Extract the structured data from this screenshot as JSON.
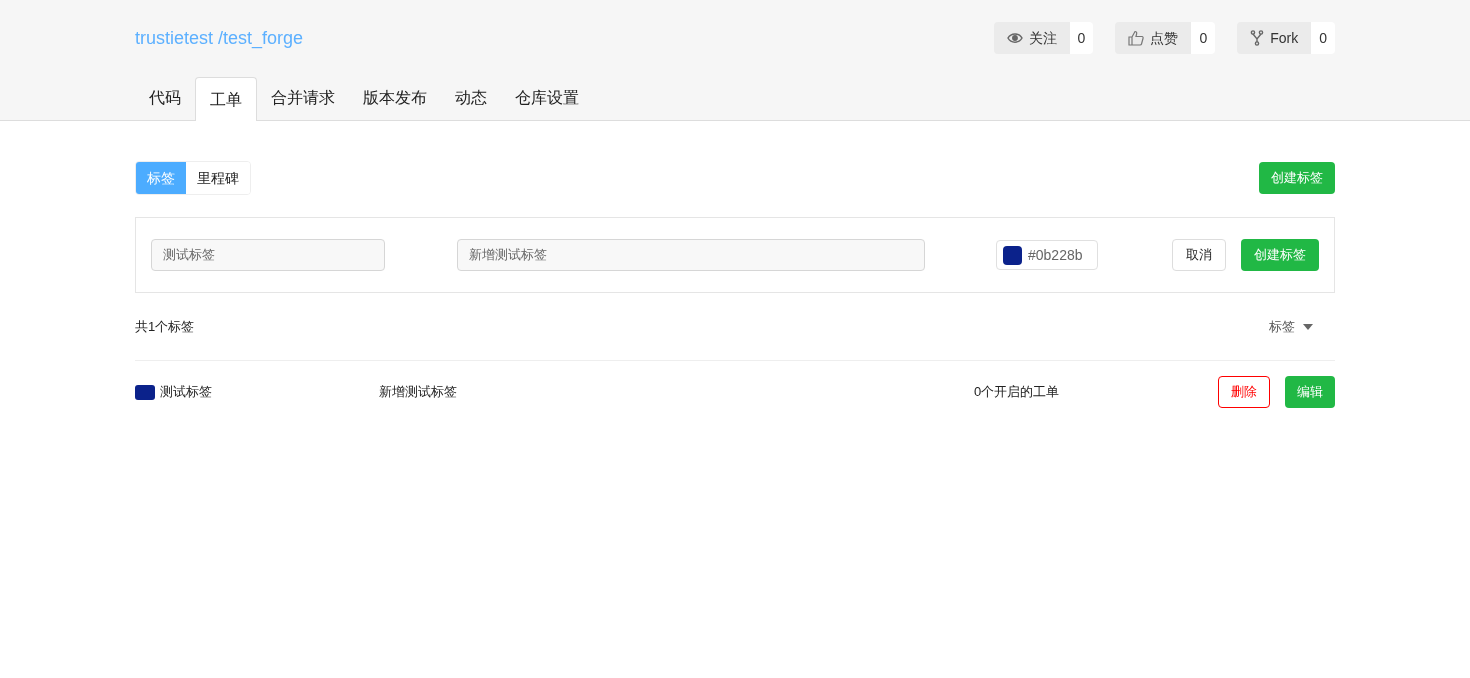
{
  "repo": {
    "title": "trustietest /test_forge"
  },
  "actions": [
    {
      "kind": "watch",
      "label": "关注",
      "count": "0"
    },
    {
      "kind": "like",
      "label": "点赞",
      "count": "0"
    },
    {
      "kind": "fork",
      "label": "Fork",
      "count": "0"
    }
  ],
  "tabs": [
    {
      "label": "代码",
      "selected": false
    },
    {
      "label": "工单",
      "selected": true
    },
    {
      "label": "合并请求",
      "selected": false
    },
    {
      "label": "版本发布",
      "selected": false
    },
    {
      "label": "动态",
      "selected": false
    },
    {
      "label": "仓库设置",
      "selected": false
    }
  ],
  "subtabs": [
    {
      "label": "标签",
      "selected": true
    },
    {
      "label": "里程碑",
      "selected": false
    }
  ],
  "create_button": "创建标签",
  "form": {
    "name": "测试标签",
    "description": "新增测试标签",
    "color": "#0b228b",
    "color_text": "#0b228b",
    "cancel": "取消",
    "submit": "创建标签"
  },
  "summary": "共1个标签",
  "sort": "标签",
  "labels": [
    {
      "name": "测试标签",
      "color": "#0b228b",
      "description": "新增测试标签",
      "issues": "0个开启的工单",
      "delete": "删除",
      "edit": "编辑"
    }
  ]
}
